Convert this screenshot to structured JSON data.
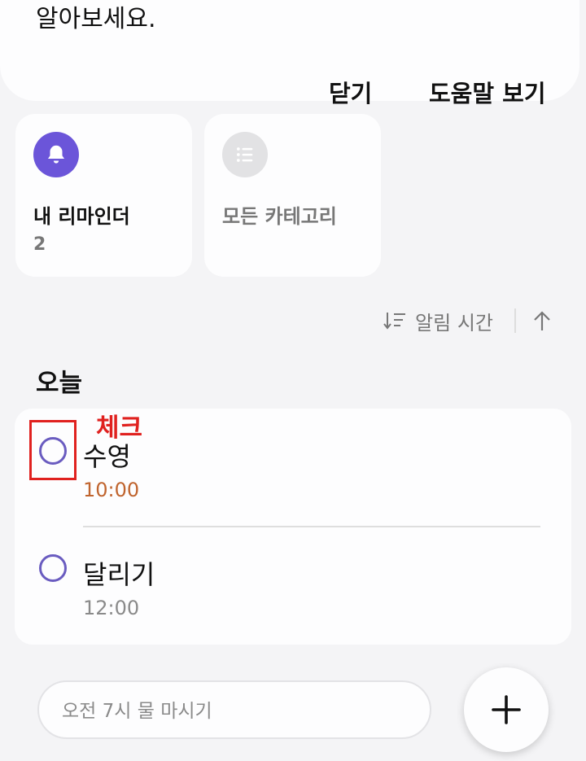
{
  "top_card": {
    "cut_text": "알아보세요.",
    "close_label": "닫기",
    "help_label": "도움말 보기"
  },
  "categories": [
    {
      "label": "내 리마인더",
      "count": "2",
      "icon": "bell-icon",
      "icon_bg": "#6b55d9"
    },
    {
      "label": "모든 카테고리",
      "count": "",
      "icon": "list-icon",
      "icon_bg": "#e2e2e4"
    }
  ],
  "sort": {
    "label": "알림 시간",
    "icon": "sort-icon",
    "direction_icon": "arrow-up-icon"
  },
  "section": {
    "title": "오늘"
  },
  "reminders": [
    {
      "title": "수영",
      "time": "10:00",
      "time_color": "#c0642e"
    },
    {
      "title": "달리기",
      "time": "12:00",
      "time_color": "#8a8a8a"
    }
  ],
  "annotation": {
    "text": "체크",
    "color": "#e0211f"
  },
  "quick_add": {
    "placeholder": "오전 7시 물 마시기"
  },
  "fab": {
    "icon": "plus-icon"
  }
}
